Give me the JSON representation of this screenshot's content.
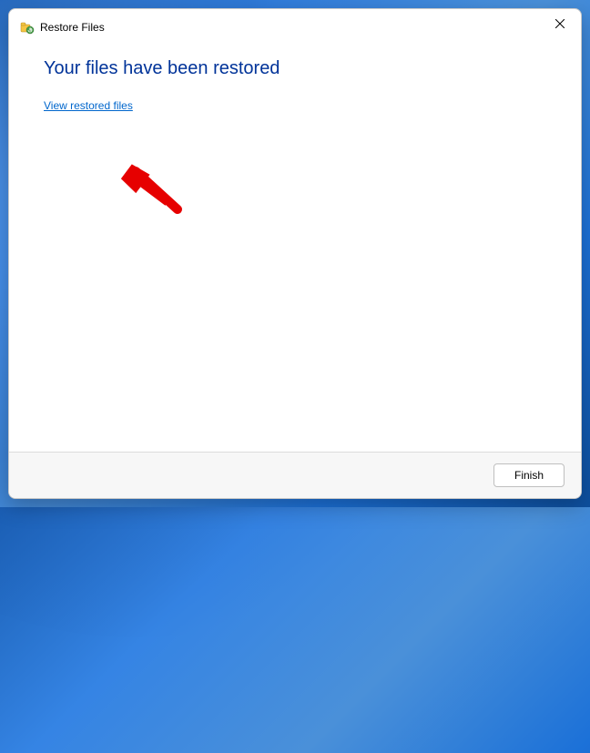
{
  "titlebar": {
    "title": "Restore Files"
  },
  "content": {
    "heading": "Your files have been restored",
    "link_label": "View restored files"
  },
  "footer": {
    "finish_label": "Finish"
  }
}
